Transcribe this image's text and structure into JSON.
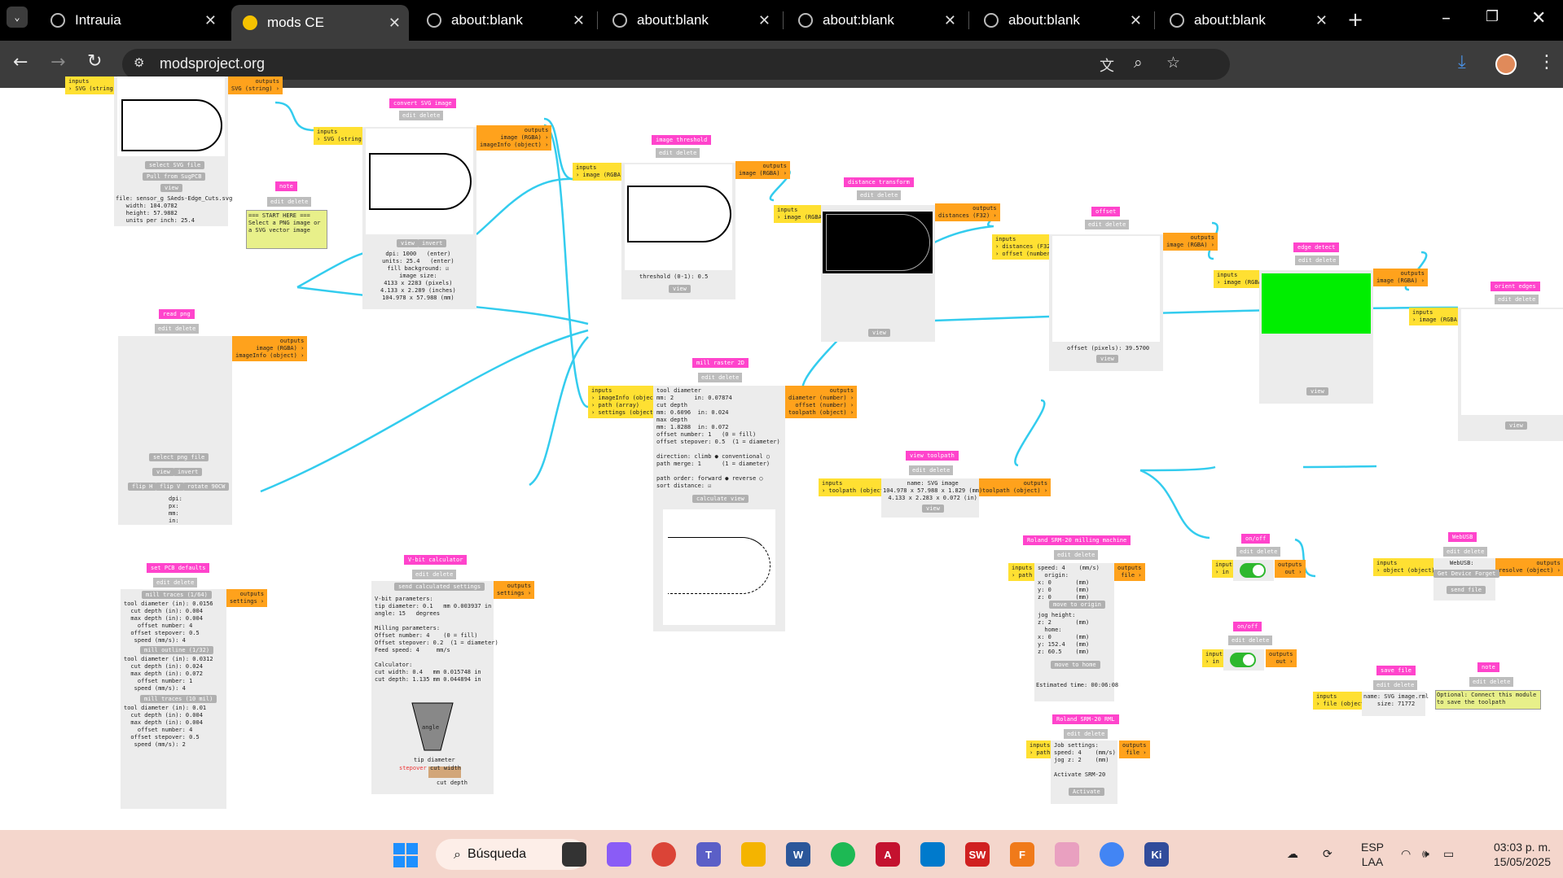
{
  "browser": {
    "tabs": [
      {
        "label": "Intrauia",
        "active": false
      },
      {
        "label": "mods CE",
        "active": true
      },
      {
        "label": "about:blank",
        "active": false
      },
      {
        "label": "about:blank",
        "active": false
      },
      {
        "label": "about:blank",
        "active": false
      },
      {
        "label": "about:blank",
        "active": false
      },
      {
        "label": "about:blank",
        "active": false
      }
    ],
    "url": "modsproject.org"
  },
  "modules": {
    "svg_input": {
      "inputs": "inputs\n› SVG (string)",
      "outputs": "outputs\nSVG (string) ›",
      "btn1": "select SVG file",
      "btn2": "Pull from SugPCB",
      "btn3": "view",
      "info": "file: sensor_g SAeds-Edge_Cuts.svg\n   width: 104.0782\n   height: 57.9882\n   units per inch: 25.4"
    },
    "convert_svg": {
      "title": "convert SVG image",
      "btns": "edit delete",
      "inputs": "inputs\n› SVG (string)",
      "outputs": "outputs\nimage (RGBA) ›\nimageInfo (object) ›",
      "view": "view",
      "invert": "invert",
      "info": "dpi: 1000   (enter)\nunits: 25.4   (enter)\nfill background: ☑\nimage size:\n4133 x 2283 (pixels)\n4.133 x 2.289 (inches)\n104.978 x 57.988 (mm)"
    },
    "note1": {
      "title": "note",
      "btns": "edit delete",
      "text": "=== START HERE ===\nSelect a PNG image or\na SVG vector image"
    },
    "read_png": {
      "title": "read png",
      "btns": "edit delete",
      "outputs": "outputs\nimage (RGBA) ›\nimageInfo (object) ›",
      "btn_select": "select png file",
      "btn_view": "view",
      "btn_invert": "invert",
      "btn_flipx": "flip H",
      "btn_flipy": "flip V",
      "btn_rot": "rotate 90CW",
      "info": "dpi:\npx:\nmm:\nin:"
    },
    "threshold": {
      "title": "image threshold",
      "btns": "edit delete",
      "inputs": "inputs\n› image (RGBA)",
      "outputs": "outputs\nimage (RGBA) ›",
      "info": "threshold (0-1): 0.5",
      "view": "view"
    },
    "distance": {
      "title": "distance transform",
      "btns": "edit delete",
      "inputs": "inputs\n› image (RGBA)",
      "outputs": "outputs\ndistances (F32) ›",
      "view": "view"
    },
    "offset": {
      "title": "offset",
      "btns": "edit delete",
      "inputs": "inputs\n› distances (F32)\n› offset (number)",
      "outputs": "outputs\nimage (RGBA) ›",
      "info": "offset (pixels): 39.5700",
      "view": "view"
    },
    "edge": {
      "title": "edge detect",
      "btns": "edit delete",
      "inputs": "inputs\n› image (RGBA)",
      "outputs": "outputs\nimage (RGBA) ›",
      "view": "view"
    },
    "orient": {
      "title": "orient edges",
      "btns": "edit delete",
      "inputs": "inputs\n› image (RGBA)",
      "view": "view"
    },
    "mill_raster": {
      "title": "mill raster 2D",
      "btns": "edit delete",
      "inputs": "inputs\n› imageInfo (object)\n› path (array)\n› settings (object)",
      "outputs": "outputs\ndiameter (number) ›\noffset (number) ›\ntoolpath (object) ›",
      "info": "tool diameter\nmm: 2      in: 0.07874\ncut depth\nmm: 0.6096  in: 0.024\nmax depth\nmm: 1.8288  in: 0.072\noffset number: 1   (0 = fill)\noffset stepover: 0.5  (1 = diameter)\n\ndirection: climb ● conventional ○\npath merge: 1      (1 = diameter)\n\npath order: forward ● reverse ○\nsort distance: ☑",
      "calc": "calculate",
      "view": "view"
    },
    "view_toolpath": {
      "title": "view toolpath",
      "btns": "edit delete",
      "inputs": "inputs\n› toolpath (object)",
      "outputs": "outputs\ntoolpath (object) ›",
      "info": "name: SVG image\n104.978 x 57.988 x 1.829 (mm)\n4.133 x 2.283 x 0.072 (in)",
      "view": "view"
    },
    "pcb_defaults": {
      "title": "set PCB defaults",
      "btns": "edit delete",
      "outputs": "outputs\nsettings ›",
      "sec1": "mill traces (1/64)",
      "sec2": "mill outline (1/32)",
      "sec3": "mill traces (10 mil)",
      "info1": "tool diameter (in): 0.0156\n  cut depth (in): 0.004\n  max depth (in): 0.004\n    offset number: 4\n  offset stepover: 0.5\n   speed (mm/s): 4",
      "info2": "tool diameter (in): 0.0312\n  cut depth (in): 0.024\n  max depth (in): 0.072\n    offset number: 1\n   speed (mm/s): 4",
      "info3": "tool diameter (in): 0.01\n  cut depth (in): 0.004\n  max depth (in): 0.004\n    offset number: 4\n  offset stepover: 0.5\n   speed (mm/s): 2"
    },
    "vbit": {
      "title": "V-bit calculator",
      "btns": "edit delete",
      "outputs": "outputs\nsettings ›",
      "send": "send calculated settings",
      "info": "V-bit parameters:\ntip diameter: 0.1   mm 0.003937 in\nangle: 15   degrees\n\nMilling parameters:\nOffset number: 4    (0 = fill)\nOffset stepover: 0.2  (1 = diameter)\nFeed speed: 4     mm/s\n\nCalculator:\ncut width: 0.4   mm 0.015748 in\ncut depth: 1.135 mm 0.044894 in",
      "angle": "angle",
      "tip": "tip diameter",
      "stepover": "stepover",
      "cutwidth": "cut width",
      "cutdepth": "cut depth"
    },
    "roland": {
      "title": "Roland SRM-20 milling machine",
      "btns": "edit delete",
      "inputs": "inputs\n› path",
      "outputs": "outputs\nfile ›",
      "info": "speed: 4    (mm/s)\n  origin:\nx: 0       (mm)\ny: 0       (mm)\nz: 0       (mm)",
      "move_origin": "move to origin",
      "info2": "jog height:\nz: 2       (mm)\n  home:\nx: 0       (mm)\ny: 152.4   (mm)\nz: 60.5    (mm)",
      "move_home": "move to home",
      "est": "Estimated time: 00:06:08"
    },
    "roland_rml": {
      "title": "Roland SRM-20 RML",
      "btns": "edit delete",
      "inputs": "inputs\n› path",
      "outputs": "outputs\nfile ›",
      "info": "Job settings:\nspeed: 4    (mm/s)\njog z: 2    (mm)\n\nActivate SRM-20",
      "activate": "Activate"
    },
    "onoff1": {
      "title": "on/off",
      "btns": "edit delete",
      "inputs": "inputs\n› in",
      "outputs": "outputs\nout ›"
    },
    "onoff2": {
      "title": "on/off",
      "btns": "edit delete",
      "inputs": "inputs\n› in",
      "outputs": "outputs\nout ›"
    },
    "websocket": {
      "title": "WebUSB",
      "btns": "edit delete",
      "inputs": "inputs\n› object (object)",
      "outputs": "outputs\nresolve (object) ›",
      "info": "WebUSB:",
      "b1": "Get Device",
      "b2": "Forget",
      "b3": "send file"
    },
    "save_file": {
      "title": "save file",
      "btns": "edit delete",
      "inputs": "inputs\n› file (object)",
      "info": "name: SVG image.rml\nsize: 71772"
    },
    "note2": {
      "title": "note",
      "btns": "edit delete",
      "text": "Optional: Connect this module\nto save the toolpath"
    }
  },
  "taskbar": {
    "search": "Búsqueda",
    "lang1": "ESP",
    "lang2": "LAA",
    "time": "03:03 p. m.",
    "date": "15/05/2025"
  },
  "colors": {
    "wire": "#33ccee",
    "title": "#ff44cc",
    "input": "#ffe032",
    "output": "#ffa21c",
    "edge_image": "#00ee00"
  }
}
